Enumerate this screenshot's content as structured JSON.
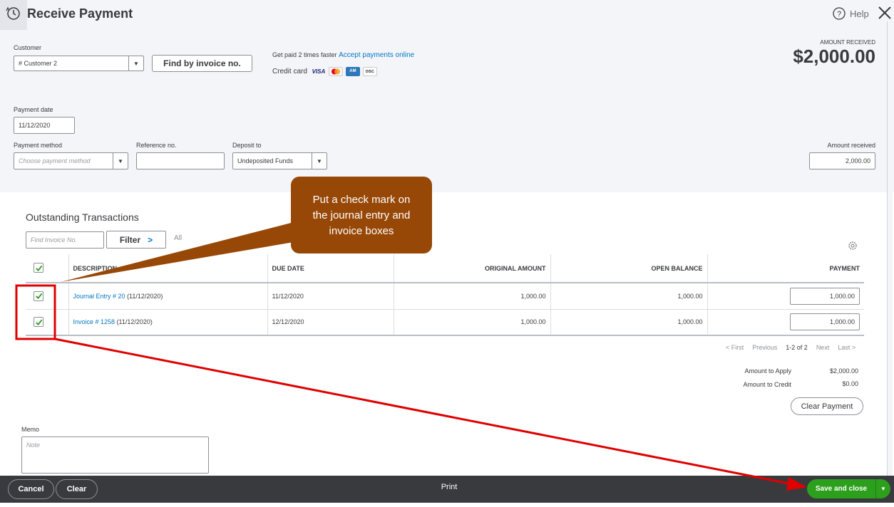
{
  "header": {
    "title": "Receive Payment",
    "help_label": "Help"
  },
  "customer": {
    "label": "Customer",
    "value": "# Customer 2",
    "find_button": "Find by invoice no."
  },
  "promo": {
    "text": "Get paid 2 times faster",
    "link": "Accept payments online",
    "credit_label": "Credit card",
    "cards": [
      "VISA",
      "MC",
      "AMEX",
      "DISCOVER"
    ]
  },
  "amount_received_header": {
    "label": "AMOUNT RECEIVED",
    "value": "$2,000.00"
  },
  "payment_date": {
    "label": "Payment date",
    "value": "11/12/2020"
  },
  "payment_method": {
    "label": "Payment method",
    "placeholder": "Choose payment method"
  },
  "reference": {
    "label": "Reference no.",
    "value": ""
  },
  "deposit_to": {
    "label": "Deposit to",
    "value": "Undeposited Funds"
  },
  "amount_received_field": {
    "label": "Amount received",
    "value": "2,000.00"
  },
  "outstanding": {
    "title": "Outstanding Transactions",
    "find_placeholder": "Find Invoice No.",
    "filter_label": "Filter",
    "filter_chevron": ">",
    "all_label": "All",
    "columns": [
      "DESCRIPTION",
      "DUE DATE",
      "ORIGINAL AMOUNT",
      "OPEN BALANCE",
      "PAYMENT"
    ],
    "rows": [
      {
        "checked": true,
        "link": "Journal Entry # 20",
        "date_suffix": "(11/12/2020)",
        "due_date": "11/12/2020",
        "original": "1,000.00",
        "open": "1,000.00",
        "payment": "1,000.00"
      },
      {
        "checked": true,
        "link": "Invoice # 1258",
        "date_suffix": "(11/12/2020)",
        "due_date": "12/12/2020",
        "original": "1,000.00",
        "open": "1,000.00",
        "payment": "1,000.00"
      }
    ]
  },
  "pager": {
    "first": "< First",
    "previous": "Previous",
    "range": "1-2 of 2",
    "next": "Next",
    "last": "Last >"
  },
  "summary": {
    "apply_label": "Amount to Apply",
    "apply_value": "$2,000.00",
    "credit_label": "Amount to Credit",
    "credit_value": "$0.00",
    "clear_payment": "Clear Payment"
  },
  "memo": {
    "label": "Memo",
    "placeholder": "Note"
  },
  "footer": {
    "cancel": "Cancel",
    "clear": "Clear",
    "print": "Print",
    "save_close": "Save and close",
    "dropdown_arrow": "▼"
  },
  "callout": {
    "line1": "Put a check mark on",
    "line2": "the journal entry and",
    "line3": "invoice boxes"
  },
  "colors": {
    "accent_green": "#2ca01c",
    "link_blue": "#0077c5",
    "callout_brown": "#974807",
    "annotation_red": "#e00000"
  }
}
